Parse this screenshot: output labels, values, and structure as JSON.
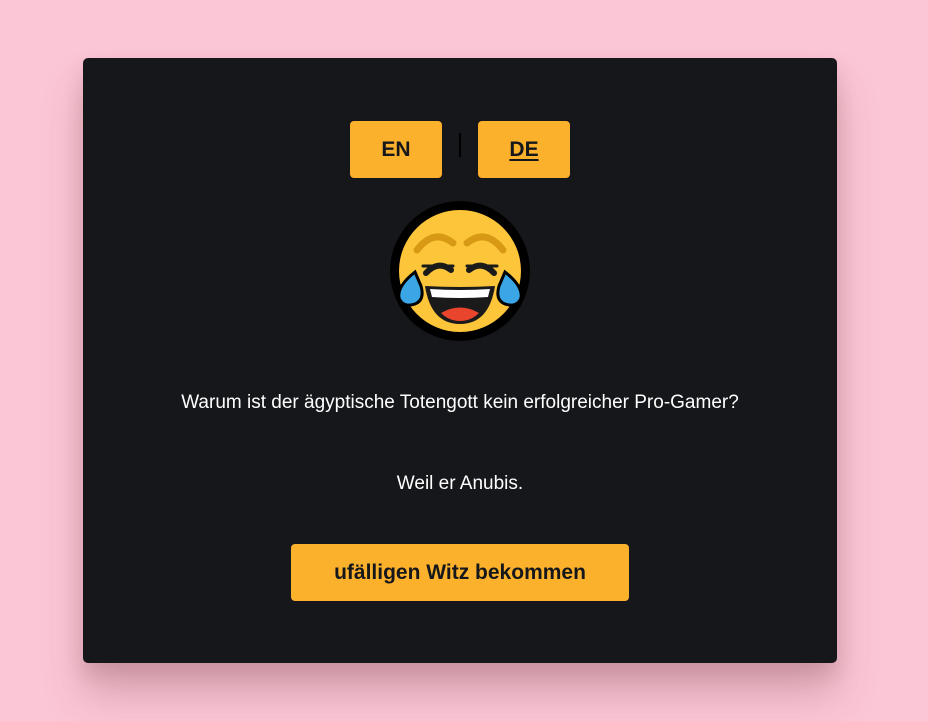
{
  "language_switcher": {
    "en_label": "EN",
    "de_label": "DE",
    "active": "DE"
  },
  "emoji": {
    "icon": "face-with-tears-of-joy-icon"
  },
  "joke": {
    "question": "Warum ist der ägyptische Totengott kein erfolgreicher Pro-Gamer?",
    "answer": "Weil er Anubis."
  },
  "actions": {
    "random_joke_label": "ufälligen Witz bekommen"
  },
  "colors": {
    "page_background": "#fbc6d6",
    "card_background": "#16171b",
    "accent": "#fbb12c",
    "text": "#ffffff"
  }
}
